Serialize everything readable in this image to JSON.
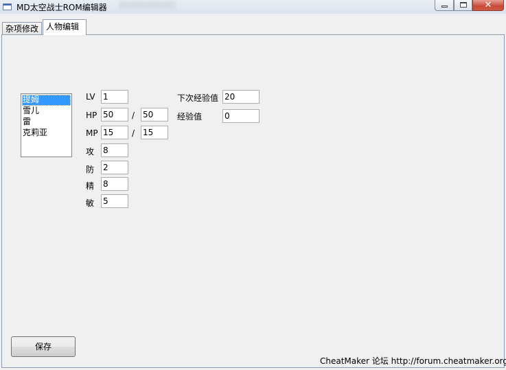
{
  "window": {
    "title": "MD太空战士ROM编辑器"
  },
  "tabs": [
    {
      "label": "杂项修改"
    },
    {
      "label": "人物编辑"
    }
  ],
  "characters": {
    "items": [
      "提姆",
      "雪儿",
      "雷",
      "克莉亚"
    ],
    "selected": "提姆"
  },
  "stats": {
    "lv": {
      "label": "LV",
      "value": "1"
    },
    "hp": {
      "label": "HP",
      "value": "50",
      "separator": "/",
      "max": "50"
    },
    "mp": {
      "label": "MP",
      "value": "15",
      "separator": "/",
      "max": "15"
    },
    "atk": {
      "label": "攻",
      "value": "8"
    },
    "def": {
      "label": "防",
      "value": "2"
    },
    "spirit": {
      "label": "精",
      "value": "8"
    },
    "agi": {
      "label": "敏",
      "value": "5"
    },
    "next_exp": {
      "label": "下次经验值",
      "value": "20"
    },
    "exp": {
      "label": "经验值",
      "value": "0"
    }
  },
  "buttons": {
    "save": "保存"
  },
  "footer": {
    "text": "CheatMaker 论坛 http://forum.cheatmaker.org/"
  }
}
